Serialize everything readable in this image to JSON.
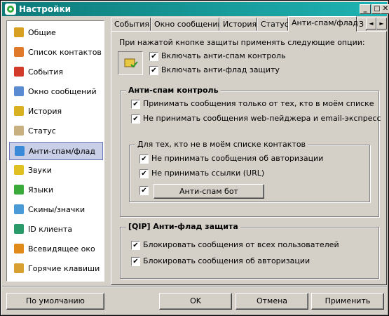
{
  "window": {
    "title": "Настройки",
    "controls": {
      "minimize": "_",
      "maximize": "□",
      "close": "✕"
    }
  },
  "sidebar": {
    "items": [
      {
        "label": "Общие",
        "icon": "settings-icon",
        "color": "#d8a020"
      },
      {
        "label": "Список контактов",
        "icon": "contacts-icon",
        "color": "#e07a2a"
      },
      {
        "label": "События",
        "icon": "events-icon",
        "color": "#d23a2a"
      },
      {
        "label": "Окно сообщений",
        "icon": "message-window-icon",
        "color": "#5a8ad2"
      },
      {
        "label": "История",
        "icon": "history-icon",
        "color": "#d8b020"
      },
      {
        "label": "Статус",
        "icon": "status-icon",
        "color": "#c8b080"
      },
      {
        "label": "Анти-спам/флад",
        "icon": "antispam-icon",
        "color": "#3a8ad8"
      },
      {
        "label": "Звуки",
        "icon": "sounds-icon",
        "color": "#e0c020"
      },
      {
        "label": "Языки",
        "icon": "languages-icon",
        "color": "#3aaa3a"
      },
      {
        "label": "Скины/значки",
        "icon": "skins-icon",
        "color": "#4a9ad8"
      },
      {
        "label": "ID клиента",
        "icon": "client-id-icon",
        "color": "#2a9a6a"
      },
      {
        "label": "Всевидящее око",
        "icon": "eye-icon",
        "color": "#e08a1a"
      },
      {
        "label": "Горячие клавиши",
        "icon": "hotkeys-icon",
        "color": "#d8a030"
      }
    ],
    "selected_index": 6
  },
  "tabs": {
    "items": [
      "События",
      "Окно сообщений",
      "История",
      "Статус",
      "Анти-спам/флад",
      "З"
    ],
    "active_index": 4,
    "arrows": {
      "left": "◄",
      "right": "►"
    }
  },
  "panel": {
    "intro": "При нажатой кнопке защиты применять следующие опции:",
    "top_options": [
      {
        "label": "Включать анти-спам контроль",
        "checked": true
      },
      {
        "label": "Включать анти-флад защиту",
        "checked": true
      }
    ],
    "antispam": {
      "title": "Анти-спам контроль",
      "options": [
        {
          "label": "Принимать сообщения только от тех, кто в моём списке",
          "checked": true
        },
        {
          "label": "Не принимать сообщения web-пейджера и email-экспресс",
          "checked": true
        }
      ],
      "sub": {
        "title": "Для тех, кто не в моём списке контактов",
        "options": [
          {
            "label": "Не принимать сообщения об авторизации",
            "checked": true
          },
          {
            "label": "Не принимать ссылки (URL)",
            "checked": true
          }
        ],
        "bot_checked": true,
        "bot_button": "Анти-спам бот"
      }
    },
    "antiflood": {
      "title": "[QIP] Анти-флад защита",
      "options": [
        {
          "label": "Блокировать сообщения от всех пользователей",
          "checked": true
        },
        {
          "label": "Блокировать сообщения об авторизации",
          "checked": true
        }
      ]
    }
  },
  "footer": {
    "defaults_button": "По умолчанию",
    "ok_button": "OK",
    "cancel_button": "Отмена",
    "apply_button": "Применить"
  },
  "check_glyph": "✔"
}
